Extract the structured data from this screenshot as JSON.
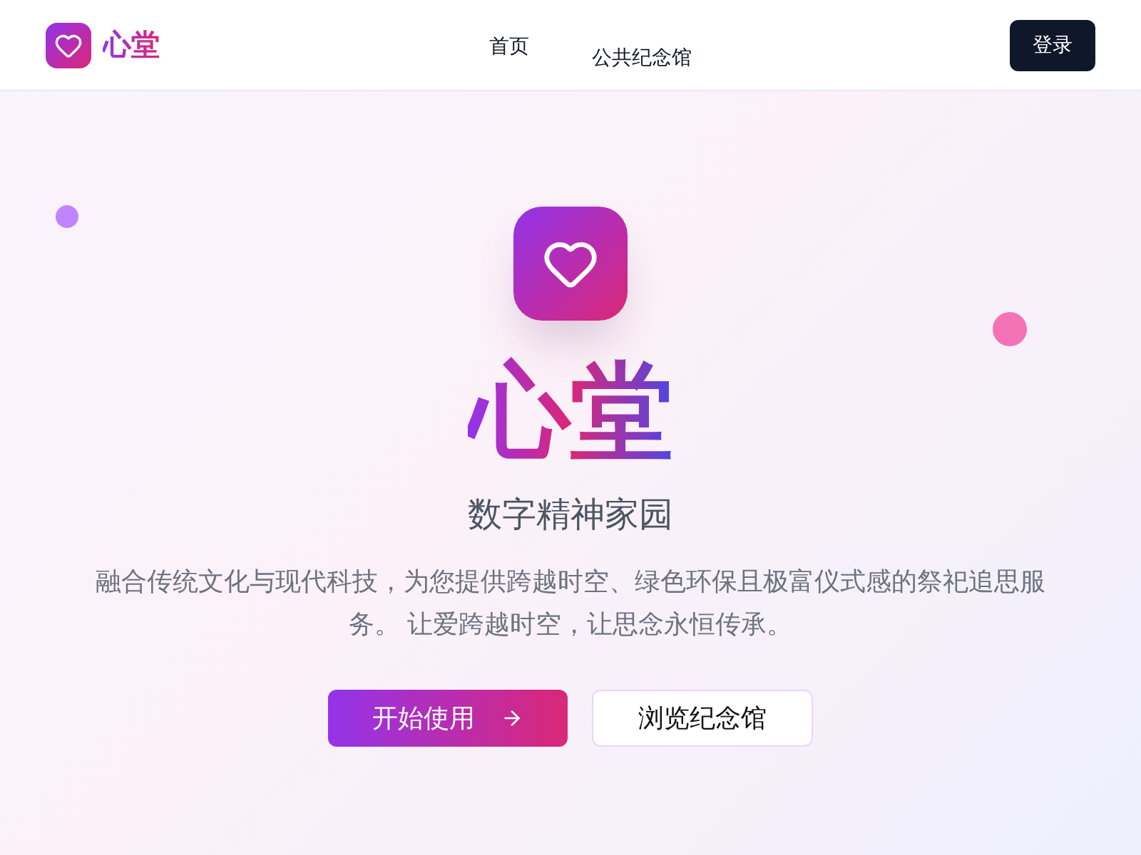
{
  "header": {
    "logo_text": "心堂",
    "nav": [
      {
        "label": "首页"
      },
      {
        "label": "公共纪念馆"
      }
    ],
    "login_button": "登录"
  },
  "hero": {
    "title": "心堂",
    "subtitle": "数字精神家园",
    "description": "融合传统文化与现代科技，为您提供跨越时空、绿色环保且极富仪式感的祭祀追思服务。 让爱跨越时空，让思念永恒传承。",
    "buttons": [
      {
        "label": "开始使用",
        "kind": "primary"
      },
      {
        "label": "浏览纪念馆",
        "kind": "secondary"
      }
    ]
  }
}
